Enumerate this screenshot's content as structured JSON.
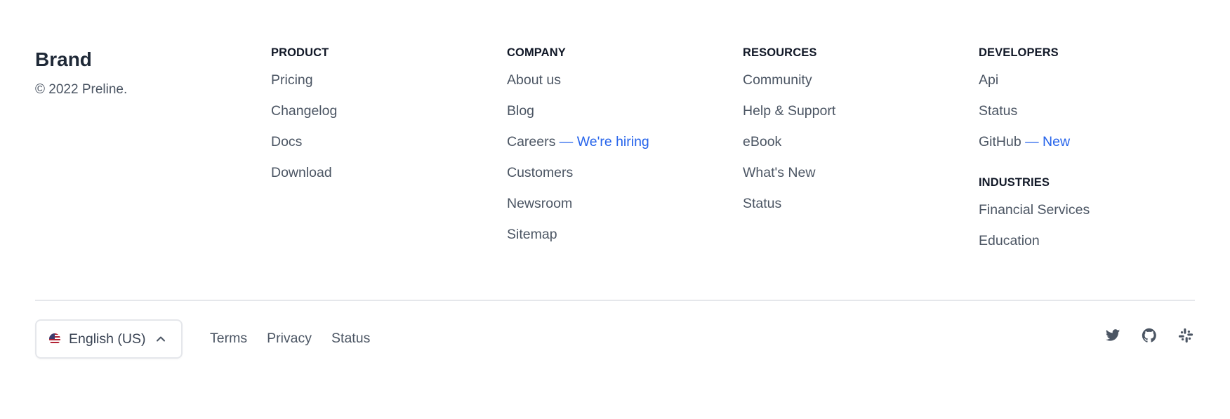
{
  "brand": {
    "name": "Brand",
    "copyright": "© 2022 Preline."
  },
  "columns": [
    {
      "heading": "Product",
      "items": [
        {
          "label": "Pricing"
        },
        {
          "label": "Changelog"
        },
        {
          "label": "Docs"
        },
        {
          "label": "Download"
        }
      ]
    },
    {
      "heading": "Company",
      "items": [
        {
          "label": "About us"
        },
        {
          "label": "Blog"
        },
        {
          "label": "Careers",
          "accent": "— We're hiring"
        },
        {
          "label": "Customers"
        },
        {
          "label": "Newsroom"
        },
        {
          "label": "Sitemap"
        }
      ]
    },
    {
      "heading": "Resources",
      "items": [
        {
          "label": "Community"
        },
        {
          "label": "Help & Support"
        },
        {
          "label": "eBook"
        },
        {
          "label": "What's New"
        },
        {
          "label": "Status"
        }
      ]
    },
    {
      "heading": "Developers",
      "items": [
        {
          "label": "Api"
        },
        {
          "label": "Status"
        },
        {
          "label": "GitHub",
          "accent": "— New"
        }
      ]
    },
    {
      "heading": "Industries",
      "items": [
        {
          "label": "Financial Services"
        },
        {
          "label": "Education"
        }
      ]
    }
  ],
  "language": {
    "label": "English (US)",
    "flag_icon": "us-flag-icon",
    "chevron_icon": "chevron-up-icon"
  },
  "bottom_links": [
    "Terms",
    "Privacy",
    "Status"
  ],
  "socials": [
    {
      "name": "twitter-icon"
    },
    {
      "name": "github-icon"
    },
    {
      "name": "slack-icon"
    }
  ],
  "colors": {
    "accent": "#2563eb",
    "text": "#4b5563",
    "heading": "#111827",
    "divider": "#e5e7eb"
  }
}
